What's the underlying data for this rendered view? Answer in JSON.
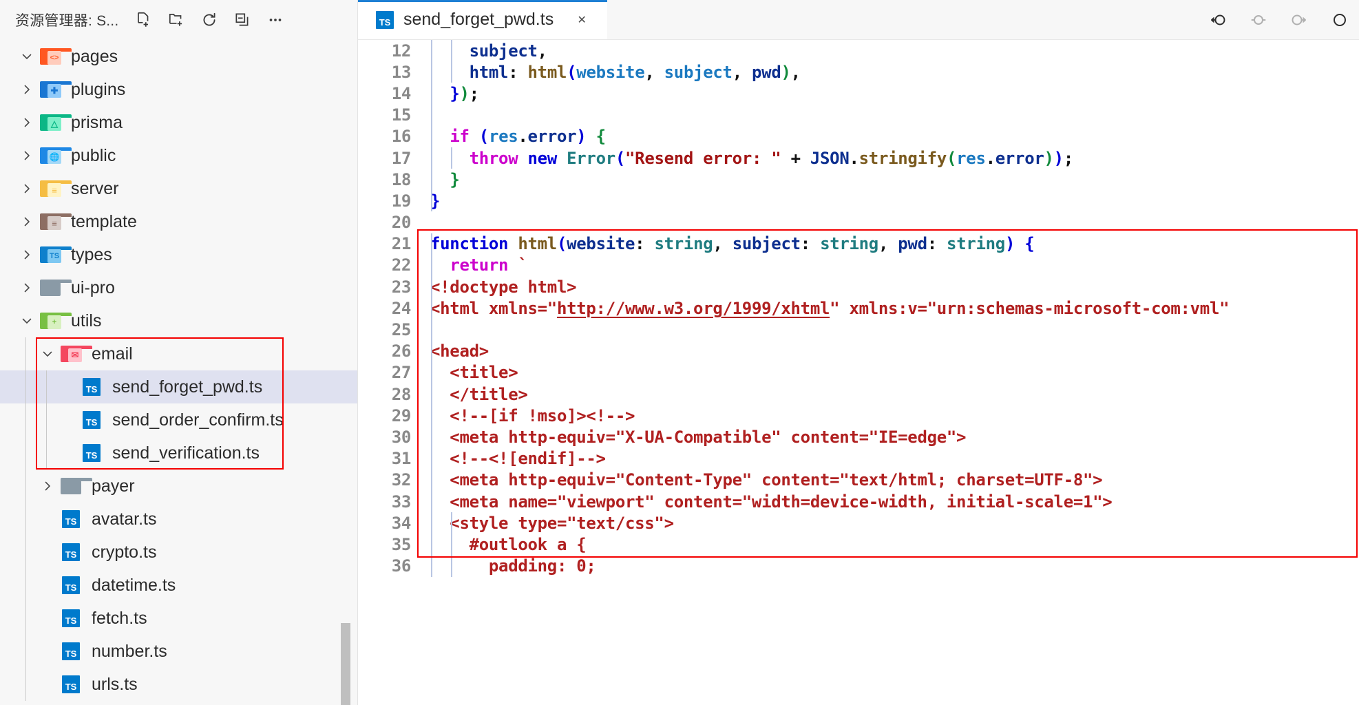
{
  "sidebar": {
    "title": "资源管理器: S...",
    "actions": [
      {
        "name": "new-file-icon",
        "label": "新建文件"
      },
      {
        "name": "new-folder-icon",
        "label": "新建文件夹"
      },
      {
        "name": "refresh-icon",
        "label": "刷新资源管理器"
      },
      {
        "name": "collapse-all-icon",
        "label": "折叠文件夹"
      },
      {
        "name": "more-actions-icon",
        "label": "视图和更多操作..."
      }
    ],
    "tree": [
      {
        "label": "pages",
        "kind": "folder",
        "icon": "folder-pages-icon",
        "depth": 0,
        "twisty": "down",
        "selected": false,
        "color": "#ff5722",
        "accent": "#ffccbc",
        "glyph": "<>"
      },
      {
        "label": "plugins",
        "kind": "folder",
        "icon": "folder-plugins-icon",
        "depth": 0,
        "twisty": "right",
        "selected": false,
        "color": "#1976d2",
        "accent": "#90caf9",
        "glyph": "puzzle"
      },
      {
        "label": "prisma",
        "kind": "folder",
        "icon": "folder-prisma-icon",
        "depth": 0,
        "twisty": "right",
        "selected": false,
        "color": "#0bb786",
        "accent": "#7defc8",
        "glyph": "prism"
      },
      {
        "label": "public",
        "kind": "folder",
        "icon": "folder-public-icon",
        "depth": 0,
        "twisty": "right",
        "selected": false,
        "color": "#1e88e5",
        "accent": "#a3d8f7",
        "glyph": "globe"
      },
      {
        "label": "server",
        "kind": "folder",
        "icon": "folder-server-icon",
        "depth": 0,
        "twisty": "right",
        "selected": false,
        "color": "#f5bd43",
        "accent": "#fff3c4",
        "glyph": "server"
      },
      {
        "label": "template",
        "kind": "folder",
        "icon": "folder-template-icon",
        "depth": 0,
        "twisty": "right",
        "selected": false,
        "color": "#8d6e63",
        "accent": "#d7ccc8",
        "glyph": "lines"
      },
      {
        "label": "types",
        "kind": "folder",
        "icon": "folder-types-icon",
        "depth": 0,
        "twisty": "right",
        "selected": false,
        "color": "#0f80cc",
        "accent": "#7ec8f2",
        "glyph": "TS"
      },
      {
        "label": "ui-pro",
        "kind": "folder",
        "icon": "folder-plain-icon",
        "depth": 0,
        "twisty": "right",
        "selected": false,
        "color": "#8a9aa6",
        "accent": "#8a9aa6",
        "glyph": ""
      },
      {
        "label": "utils",
        "kind": "folder",
        "icon": "folder-utils-icon",
        "depth": 0,
        "twisty": "down",
        "selected": false,
        "color": "#78c043",
        "accent": "#d8f0c0",
        "glyph": "+"
      },
      {
        "label": "email",
        "kind": "folder",
        "icon": "folder-email-icon",
        "depth": 1,
        "twisty": "down",
        "selected": false,
        "color": "#f4475f",
        "accent": "#ffc1cb",
        "glyph": "mail"
      },
      {
        "label": "send_forget_pwd.ts",
        "kind": "file",
        "icon": "typescript-file-icon",
        "depth": 2,
        "twisty": "none",
        "selected": true
      },
      {
        "label": "send_order_confirm.ts",
        "kind": "file",
        "icon": "typescript-file-icon",
        "depth": 2,
        "twisty": "none",
        "selected": false
      },
      {
        "label": "send_verification.ts",
        "kind": "file",
        "icon": "typescript-file-icon",
        "depth": 2,
        "twisty": "none",
        "selected": false
      },
      {
        "label": "payer",
        "kind": "folder",
        "icon": "folder-plain-icon",
        "depth": 1,
        "twisty": "right",
        "selected": false,
        "color": "#8a9aa6",
        "accent": "#8a9aa6",
        "glyph": ""
      },
      {
        "label": "avatar.ts",
        "kind": "file",
        "icon": "typescript-file-icon",
        "depth": 1,
        "twisty": "none",
        "selected": false
      },
      {
        "label": "crypto.ts",
        "kind": "file",
        "icon": "typescript-file-icon",
        "depth": 1,
        "twisty": "none",
        "selected": false
      },
      {
        "label": "datetime.ts",
        "kind": "file",
        "icon": "typescript-file-icon",
        "depth": 1,
        "twisty": "none",
        "selected": false
      },
      {
        "label": "fetch.ts",
        "kind": "file",
        "icon": "typescript-file-icon",
        "depth": 1,
        "twisty": "none",
        "selected": false
      },
      {
        "label": "number.ts",
        "kind": "file",
        "icon": "typescript-file-icon",
        "depth": 1,
        "twisty": "none",
        "selected": false
      },
      {
        "label": "urls.ts",
        "kind": "file",
        "icon": "typescript-file-icon",
        "depth": 1,
        "twisty": "none",
        "selected": false
      }
    ]
  },
  "annotations": {
    "color": "#f40000",
    "sidebar_box": {
      "label": "email-folder-highlight"
    },
    "code_box": {
      "label": "html-function-highlight"
    }
  },
  "editor": {
    "tabs": [
      {
        "label": "send_forget_pwd.ts",
        "icon": "typescript-file-icon",
        "active": true,
        "close": "✕"
      }
    ],
    "actions": [
      {
        "name": "go-back-icon"
      },
      {
        "name": "current-location-icon"
      },
      {
        "name": "go-forward-icon"
      },
      {
        "name": "more-editor-actions-icon"
      }
    ]
  },
  "code": {
    "first_line_number": 12,
    "lines": [
      {
        "n": "12",
        "tokens": [
          {
            "t": "    ",
            "c": "t-plain"
          },
          {
            "t": "subject",
            "c": "t-prop"
          },
          {
            "t": ",",
            "c": "t-punct"
          }
        ]
      },
      {
        "n": "13",
        "tokens": [
          {
            "t": "    ",
            "c": "t-plain"
          },
          {
            "t": "html",
            "c": "t-prop"
          },
          {
            "t": ": ",
            "c": "t-punct"
          },
          {
            "t": "html",
            "c": "t-fn"
          },
          {
            "t": "(",
            "c": "t-paren2"
          },
          {
            "t": "website",
            "c": "t-var"
          },
          {
            "t": ", ",
            "c": "t-punct"
          },
          {
            "t": "subject",
            "c": "t-var"
          },
          {
            "t": ", ",
            "c": "t-punct"
          },
          {
            "t": "pwd",
            "c": "t-prop"
          },
          {
            "t": ")",
            "c": "t-paren"
          },
          {
            "t": ",",
            "c": "t-punct"
          }
        ]
      },
      {
        "n": "14",
        "tokens": [
          {
            "t": "  ",
            "c": "t-plain"
          },
          {
            "t": "}",
            "c": "t-paren2"
          },
          {
            "t": ")",
            "c": "t-paren"
          },
          {
            "t": ";",
            "c": "t-punct"
          }
        ]
      },
      {
        "n": "15",
        "tokens": []
      },
      {
        "n": "16",
        "tokens": [
          {
            "t": "  ",
            "c": "t-plain"
          },
          {
            "t": "if",
            "c": "t-kw2"
          },
          {
            "t": " ",
            "c": "t-plain"
          },
          {
            "t": "(",
            "c": "t-paren2"
          },
          {
            "t": "res",
            "c": "t-var"
          },
          {
            "t": ".",
            "c": "t-punct"
          },
          {
            "t": "error",
            "c": "t-prop"
          },
          {
            "t": ")",
            "c": "t-paren2"
          },
          {
            "t": " ",
            "c": "t-plain"
          },
          {
            "t": "{",
            "c": "t-paren"
          }
        ]
      },
      {
        "n": "17",
        "tokens": [
          {
            "t": "    ",
            "c": "t-plain"
          },
          {
            "t": "throw",
            "c": "t-kw2"
          },
          {
            "t": " ",
            "c": "t-plain"
          },
          {
            "t": "new",
            "c": "t-kw"
          },
          {
            "t": " ",
            "c": "t-plain"
          },
          {
            "t": "Error",
            "c": "t-cls"
          },
          {
            "t": "(",
            "c": "t-paren2"
          },
          {
            "t": "\"Resend error: \"",
            "c": "t-str"
          },
          {
            "t": " + ",
            "c": "t-punct"
          },
          {
            "t": "JSON",
            "c": "t-prop"
          },
          {
            "t": ".",
            "c": "t-punct"
          },
          {
            "t": "stringify",
            "c": "t-fn"
          },
          {
            "t": "(",
            "c": "t-paren"
          },
          {
            "t": "res",
            "c": "t-var"
          },
          {
            "t": ".",
            "c": "t-punct"
          },
          {
            "t": "error",
            "c": "t-prop"
          },
          {
            "t": ")",
            "c": "t-paren"
          },
          {
            "t": ")",
            "c": "t-paren2"
          },
          {
            "t": ";",
            "c": "t-punct"
          }
        ]
      },
      {
        "n": "18",
        "tokens": [
          {
            "t": "  ",
            "c": "t-plain"
          },
          {
            "t": "}",
            "c": "t-paren"
          }
        ]
      },
      {
        "n": "19",
        "tokens": [
          {
            "t": "}",
            "c": "t-paren2"
          }
        ]
      },
      {
        "n": "20",
        "tokens": []
      },
      {
        "n": "21",
        "tokens": [
          {
            "t": "function",
            "c": "t-kw"
          },
          {
            "t": " ",
            "c": "t-plain"
          },
          {
            "t": "html",
            "c": "t-fn"
          },
          {
            "t": "(",
            "c": "t-paren2"
          },
          {
            "t": "website",
            "c": "t-prop"
          },
          {
            "t": ": ",
            "c": "t-punct"
          },
          {
            "t": "string",
            "c": "t-type"
          },
          {
            "t": ", ",
            "c": "t-punct"
          },
          {
            "t": "subject",
            "c": "t-prop"
          },
          {
            "t": ": ",
            "c": "t-punct"
          },
          {
            "t": "string",
            "c": "t-type"
          },
          {
            "t": ", ",
            "c": "t-punct"
          },
          {
            "t": "pwd",
            "c": "t-prop"
          },
          {
            "t": ": ",
            "c": "t-punct"
          },
          {
            "t": "string",
            "c": "t-type"
          },
          {
            "t": ")",
            "c": "t-paren2"
          },
          {
            "t": " ",
            "c": "t-plain"
          },
          {
            "t": "{",
            "c": "t-paren2"
          }
        ]
      },
      {
        "n": "22",
        "tokens": [
          {
            "t": "  ",
            "c": "t-plain"
          },
          {
            "t": "return",
            "c": "t-kw2"
          },
          {
            "t": " ",
            "c": "t-plain"
          },
          {
            "t": "`",
            "c": "t-html"
          }
        ]
      },
      {
        "n": "23",
        "tokens": [
          {
            "t": "<!doctype html>",
            "c": "t-html"
          }
        ]
      },
      {
        "n": "24",
        "tokens": [
          {
            "t": "<html xmlns=\"",
            "c": "t-html"
          },
          {
            "t": "http://www.w3.org/1999/xhtml",
            "c": "t-link"
          },
          {
            "t": "\" xmlns:v=\"urn:schemas-microsoft-com:vml\"",
            "c": "t-html"
          }
        ]
      },
      {
        "n": "25",
        "tokens": []
      },
      {
        "n": "26",
        "tokens": [
          {
            "t": "<head>",
            "c": "t-html"
          }
        ]
      },
      {
        "n": "27",
        "tokens": [
          {
            "t": "  <title>",
            "c": "t-html"
          }
        ]
      },
      {
        "n": "28",
        "tokens": [
          {
            "t": "  </title>",
            "c": "t-html"
          }
        ]
      },
      {
        "n": "29",
        "tokens": [
          {
            "t": "  <!--[if !mso]><!-->",
            "c": "t-html"
          }
        ]
      },
      {
        "n": "30",
        "tokens": [
          {
            "t": "  <meta http-equiv=\"X-UA-Compatible\" content=\"IE=edge\">",
            "c": "t-html"
          }
        ]
      },
      {
        "n": "31",
        "tokens": [
          {
            "t": "  <!--<![endif]-->",
            "c": "t-html"
          }
        ]
      },
      {
        "n": "32",
        "tokens": [
          {
            "t": "  <meta http-equiv=\"Content-Type\" content=\"text/html; charset=UTF-8\">",
            "c": "t-html"
          }
        ]
      },
      {
        "n": "33",
        "tokens": [
          {
            "t": "  <meta name=\"viewport\" content=\"width=device-width, initial-scale=1\">",
            "c": "t-html"
          }
        ]
      },
      {
        "n": "34",
        "tokens": [
          {
            "t": "  <style type=\"text/css\">",
            "c": "t-html"
          }
        ]
      },
      {
        "n": "35",
        "tokens": [
          {
            "t": "    #outlook a {",
            "c": "t-html"
          }
        ]
      },
      {
        "n": "36",
        "tokens": [
          {
            "t": "      padding: 0;",
            "c": "t-html"
          }
        ]
      }
    ]
  }
}
